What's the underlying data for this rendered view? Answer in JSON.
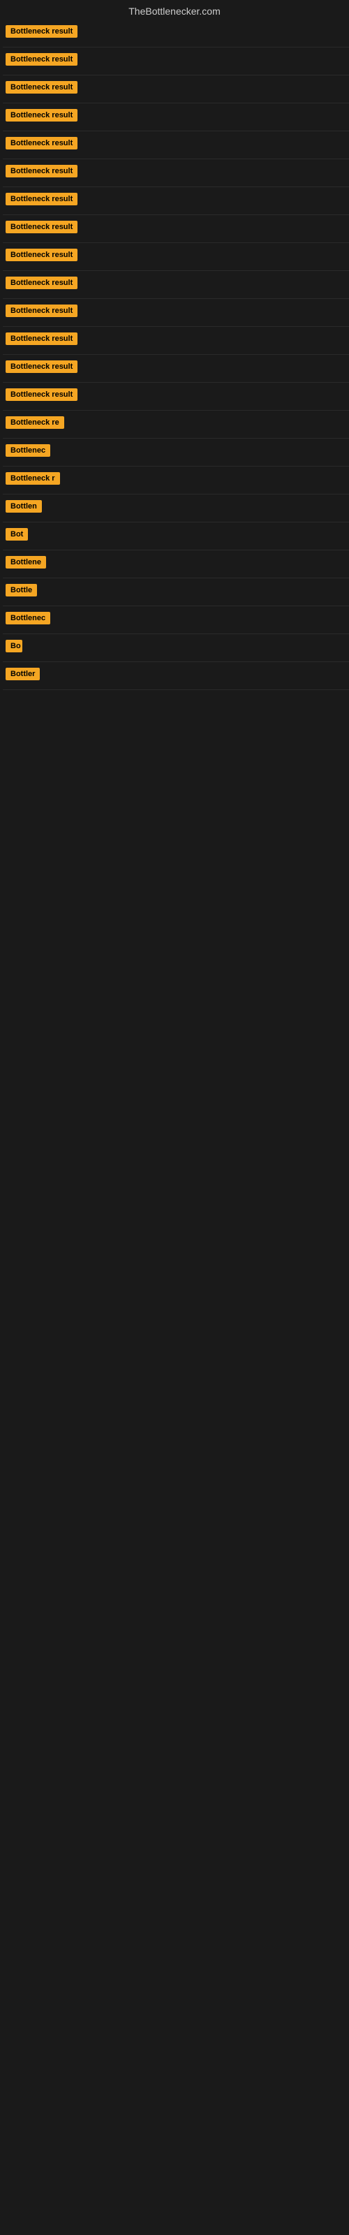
{
  "header": {
    "title": "TheBottlenecker.com"
  },
  "badges": [
    {
      "id": 1,
      "label": "Bottleneck result",
      "width": 110
    },
    {
      "id": 2,
      "label": "Bottleneck result",
      "width": 110
    },
    {
      "id": 3,
      "label": "Bottleneck result",
      "width": 110
    },
    {
      "id": 4,
      "label": "Bottleneck result",
      "width": 110
    },
    {
      "id": 5,
      "label": "Bottleneck result",
      "width": 110
    },
    {
      "id": 6,
      "label": "Bottleneck result",
      "width": 110
    },
    {
      "id": 7,
      "label": "Bottleneck result",
      "width": 110
    },
    {
      "id": 8,
      "label": "Bottleneck result",
      "width": 110
    },
    {
      "id": 9,
      "label": "Bottleneck result",
      "width": 110
    },
    {
      "id": 10,
      "label": "Bottleneck result",
      "width": 110
    },
    {
      "id": 11,
      "label": "Bottleneck result",
      "width": 110
    },
    {
      "id": 12,
      "label": "Bottleneck result",
      "width": 110
    },
    {
      "id": 13,
      "label": "Bottleneck result",
      "width": 110
    },
    {
      "id": 14,
      "label": "Bottleneck result",
      "width": 110
    },
    {
      "id": 15,
      "label": "Bottleneck re",
      "width": 92
    },
    {
      "id": 16,
      "label": "Bottlenec",
      "width": 72
    },
    {
      "id": 17,
      "label": "Bottleneck r",
      "width": 82
    },
    {
      "id": 18,
      "label": "Bottlen",
      "width": 58
    },
    {
      "id": 19,
      "label": "Bot",
      "width": 32
    },
    {
      "id": 20,
      "label": "Bottlene",
      "width": 65
    },
    {
      "id": 21,
      "label": "Bottle",
      "width": 50
    },
    {
      "id": 22,
      "label": "Bottlenec",
      "width": 72
    },
    {
      "id": 23,
      "label": "Bo",
      "width": 24
    },
    {
      "id": 24,
      "label": "Bottler",
      "width": 52
    }
  ]
}
